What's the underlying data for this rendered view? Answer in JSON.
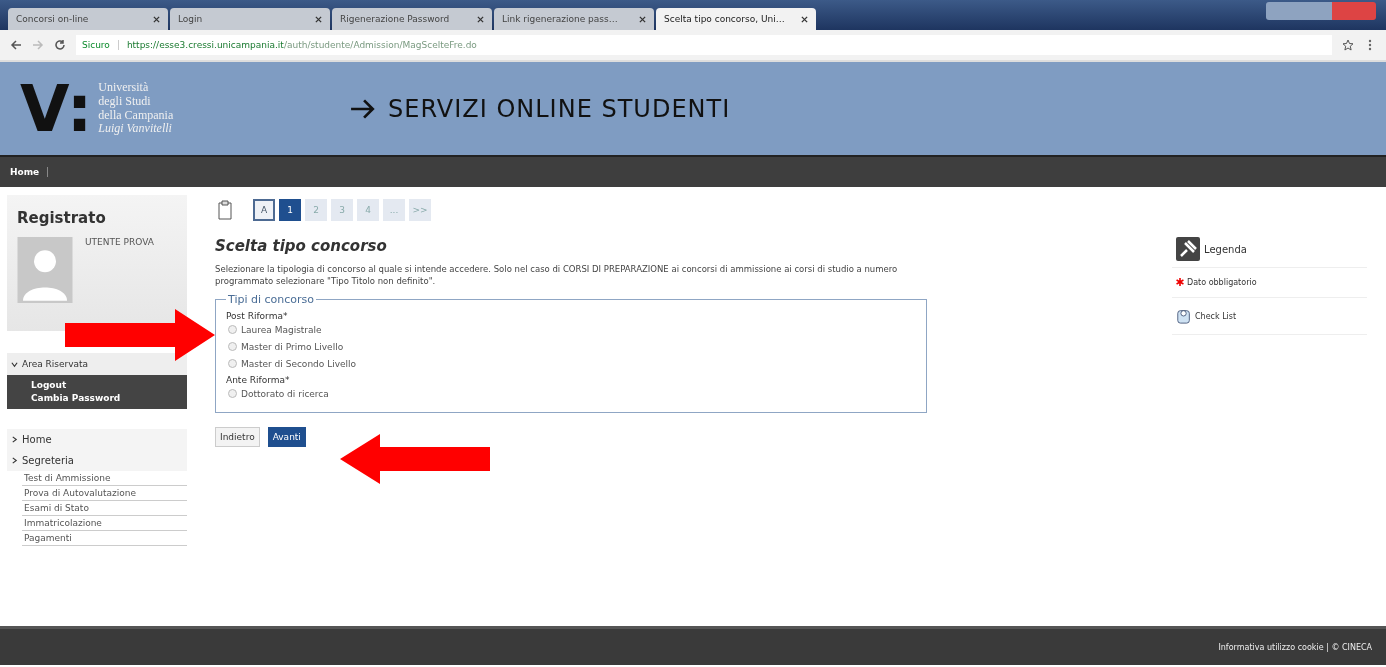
{
  "browser": {
    "tabs": [
      {
        "title": "Concorsi on-line",
        "selected": false
      },
      {
        "title": "Login",
        "selected": false
      },
      {
        "title": "Rigenerazione Password",
        "selected": false
      },
      {
        "title": "Link rigenerazione pass…",
        "selected": false
      },
      {
        "title": "Scelta tipo concorso, Uni…",
        "selected": true
      }
    ],
    "secure_label": "Sicuro",
    "url_host": "https://esse3.cressi.unicampania.it",
    "url_path": "/auth/studente/Admission/MagScelteFre.do"
  },
  "header": {
    "logo_letter": "V:",
    "logo_lines": [
      "Università",
      "degli Studi",
      "della Campania"
    ],
    "logo_sub": "Luigi Vanvitelli",
    "title": "SERVIZI ONLINE STUDENTI"
  },
  "nav": [
    "Home"
  ],
  "sidebar": {
    "status": "Registrato",
    "user": "UTENTE PROVA",
    "area": {
      "label": "Area Riservata",
      "expanded": true,
      "items": [
        "Logout",
        "Cambia Password"
      ]
    },
    "menu": [
      {
        "label": "Home",
        "expanded": false
      },
      {
        "label": "Segreteria",
        "expanded": false,
        "children": [
          "Test di Ammissione",
          "Prova di Autovalutazione",
          "Esami di Stato",
          "Immatricolazione",
          "Pagamenti"
        ]
      }
    ]
  },
  "steps": [
    {
      "label": "A",
      "selected": false
    },
    {
      "label": "1",
      "selected": true
    },
    {
      "label": "2",
      "selected": false
    },
    {
      "label": "3",
      "selected": false
    },
    {
      "label": "4",
      "selected": false
    },
    {
      "label": "...",
      "selected": false
    },
    {
      "label": ">>",
      "selected": false
    }
  ],
  "page_title": "Scelta tipo concorso",
  "intro": "Selezionare la tipologia di concorso al quale si intende accedere. Solo nel caso di CORSI DI PREPARAZIONE ai concorsi di ammissione ai corsi di studio a numero programmato selezionare \"Tipo Titolo non definito\".",
  "fieldset": {
    "legend": "Tipi di concorso",
    "groups": [
      {
        "label": "Post Riforma*",
        "options": [
          {
            "label": "Laurea Magistrale",
            "checked": false
          },
          {
            "label": "Master di Primo Livello",
            "checked": false
          },
          {
            "label": "Master di Secondo Livello",
            "checked": false
          }
        ]
      },
      {
        "label": "Ante Riforma*",
        "options": [
          {
            "label": "Dottorato di ricerca",
            "checked": false
          }
        ]
      }
    ]
  },
  "buttons": [
    {
      "label": "Indietro",
      "kind": "secondary"
    },
    {
      "label": "Avanti",
      "kind": "primary"
    }
  ],
  "legend": {
    "title": "Legenda",
    "items": [
      {
        "kind": "required",
        "label": "Dato obbligatorio"
      },
      {
        "kind": "checklist",
        "label": "Check List"
      }
    ]
  },
  "footer": "Informativa utilizzo cookie | © CINECA"
}
